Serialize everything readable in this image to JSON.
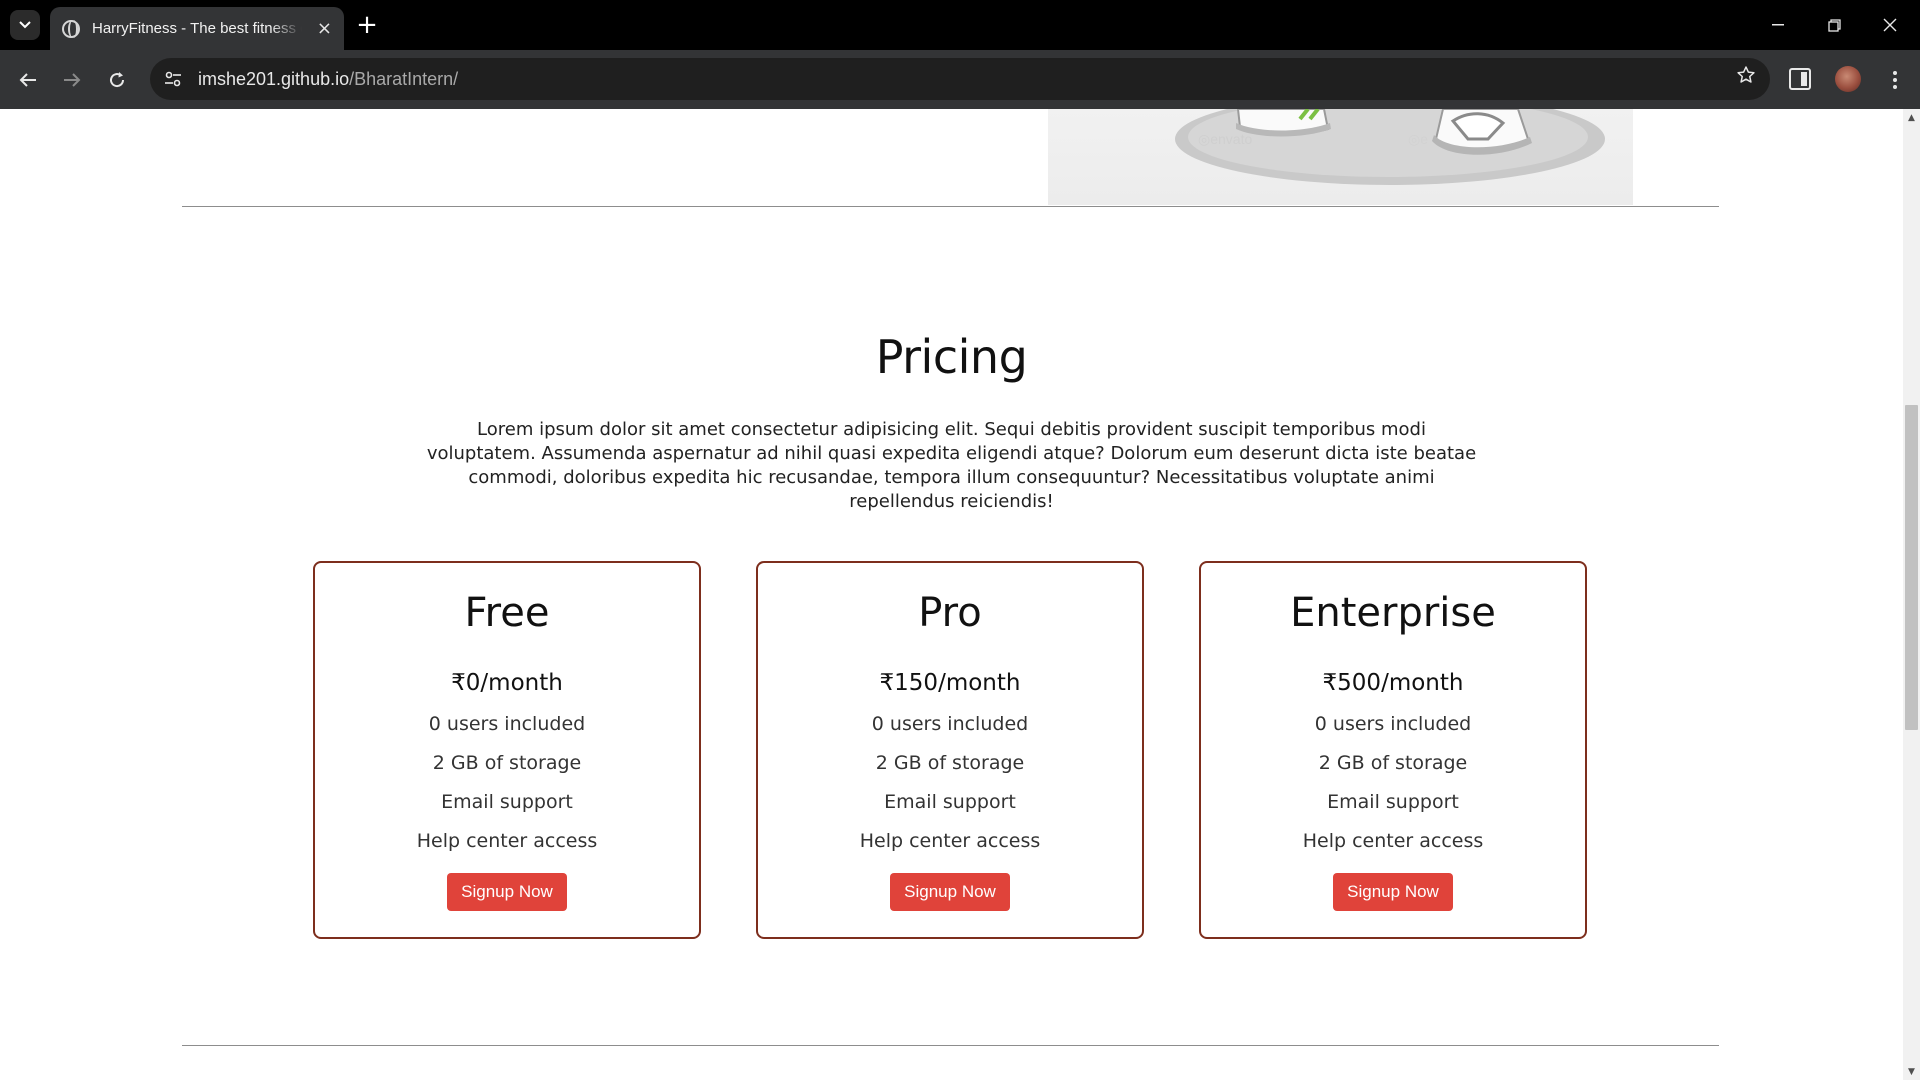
{
  "browser": {
    "tab_title": "HarryFitness - The best fitness center",
    "tab_close": "×",
    "new_tab": "+",
    "url_host": "imshe201.github.io",
    "url_path": "/BharatIntern/"
  },
  "pricing": {
    "title": "Pricing",
    "description": "Lorem ipsum dolor sit amet consectetur adipisicing elit. Sequi debitis provident suscipit temporibus modi voluptatem. Assumenda aspernatur ad nihil quasi expedita eligendi atque? Dolorum eum deserunt dicta iste beatae commodi, doloribus expedita hic recusandae, tempora illum consequuntur? Necessitatibus voluptate animi repellendus reiciendis!",
    "plans": [
      {
        "name": "Free",
        "price": "₹0/month",
        "features": [
          "0 users included",
          "2 GB of storage",
          "Email support",
          "Help center access"
        ],
        "button": "Signup Now"
      },
      {
        "name": "Pro",
        "price": "₹150/month",
        "features": [
          "0 users included",
          "2 GB of storage",
          "Email support",
          "Help center access"
        ],
        "button": "Signup Now"
      },
      {
        "name": "Enterprise",
        "price": "₹500/month",
        "features": [
          "0 users included",
          "2 GB of storage",
          "Email support",
          "Help center access"
        ],
        "button": "Signup Now"
      }
    ]
  },
  "colors": {
    "card_border": "#7d2e1d",
    "button_bg": "#e0433a",
    "divider": "#8d8d8d"
  },
  "icons": {
    "tab_list": "chevron-down-icon",
    "back": "arrow-left-icon",
    "forward": "arrow-right-icon",
    "reload": "reload-icon",
    "site_info": "tune-icon",
    "bookmark": "star-icon",
    "side_panel": "side-panel-icon",
    "menu": "kebab-menu-icon"
  }
}
